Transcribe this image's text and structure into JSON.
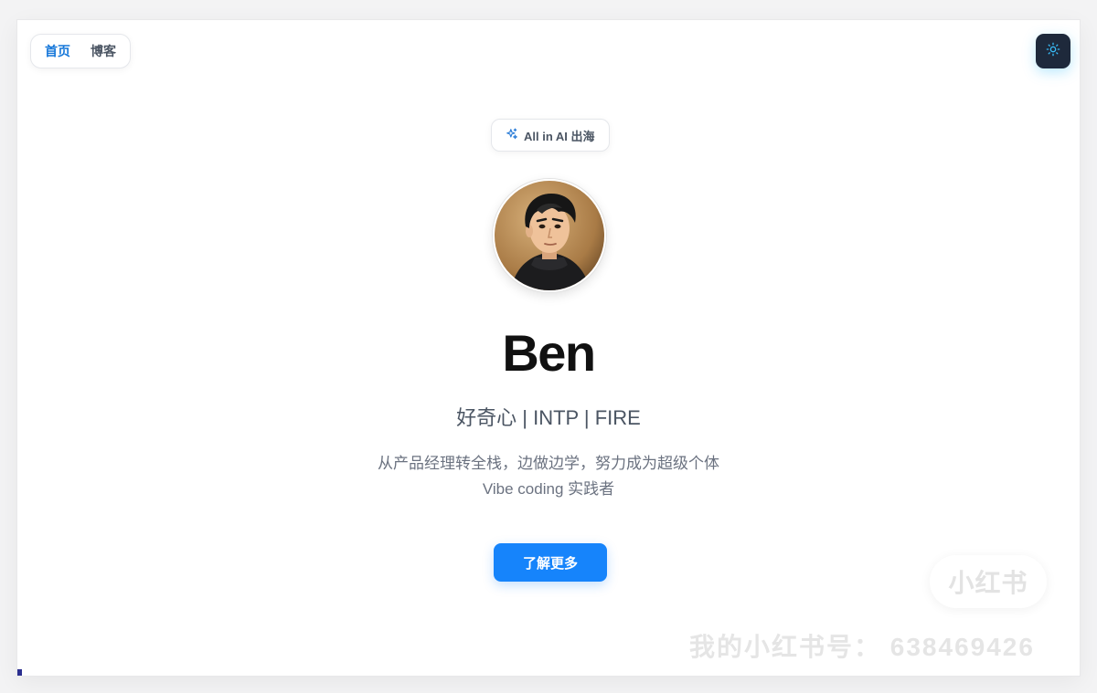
{
  "nav": {
    "items": [
      {
        "label": "首页",
        "active": true
      },
      {
        "label": "博客",
        "active": false
      }
    ]
  },
  "theme_toggle": {
    "icon": "sun-icon"
  },
  "badge": {
    "icon": "sparkles-icon",
    "label": "All in AI 出海"
  },
  "profile": {
    "avatar_alt": "avatar",
    "name": "Ben",
    "tagline": "好奇心 | INTP | FIRE",
    "description_line1": "从产品经理转全栈，边做边学，努力成为超级个体",
    "description_line2": "Vibe coding 实践者"
  },
  "cta": {
    "label": "了解更多"
  },
  "watermark": {
    "logo": "小红书",
    "text": "我的小红书号：  638469426"
  },
  "colors": {
    "accent": "#1684fb",
    "nav_active": "#1677d9",
    "theme_button": "#1e293b",
    "icon_blue": "#38bdf8"
  }
}
